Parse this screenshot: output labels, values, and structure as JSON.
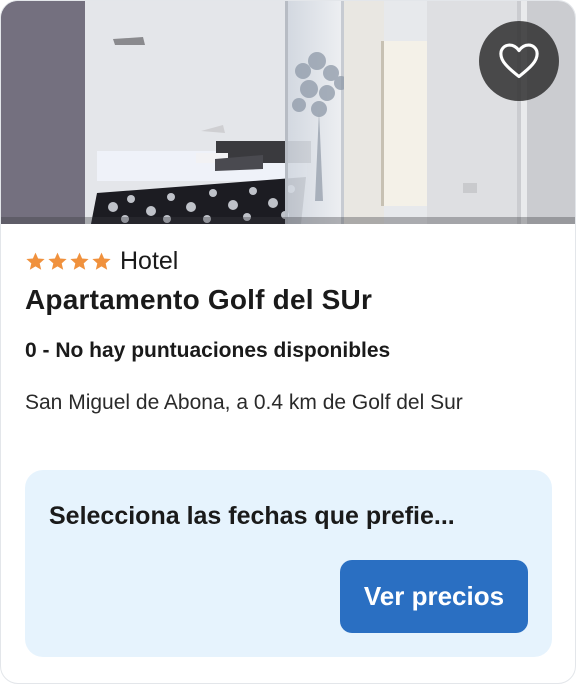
{
  "listing": {
    "star_rating": 4,
    "property_type": "Hotel",
    "title": "Apartamento Golf del SUr",
    "rating_text": "0 - No hay puntuaciones disponibles",
    "location": "San Miguel de Abona, a 0.4 km de Golf del Sur",
    "favorite_icon": "heart-outline-icon"
  },
  "pricing": {
    "prompt": "Selecciona las fechas que prefie...",
    "button_label": "Ver precios"
  },
  "colors": {
    "star": "#f0913d",
    "button": "#2a6fc2",
    "price_box_bg": "#e6f3fd"
  }
}
